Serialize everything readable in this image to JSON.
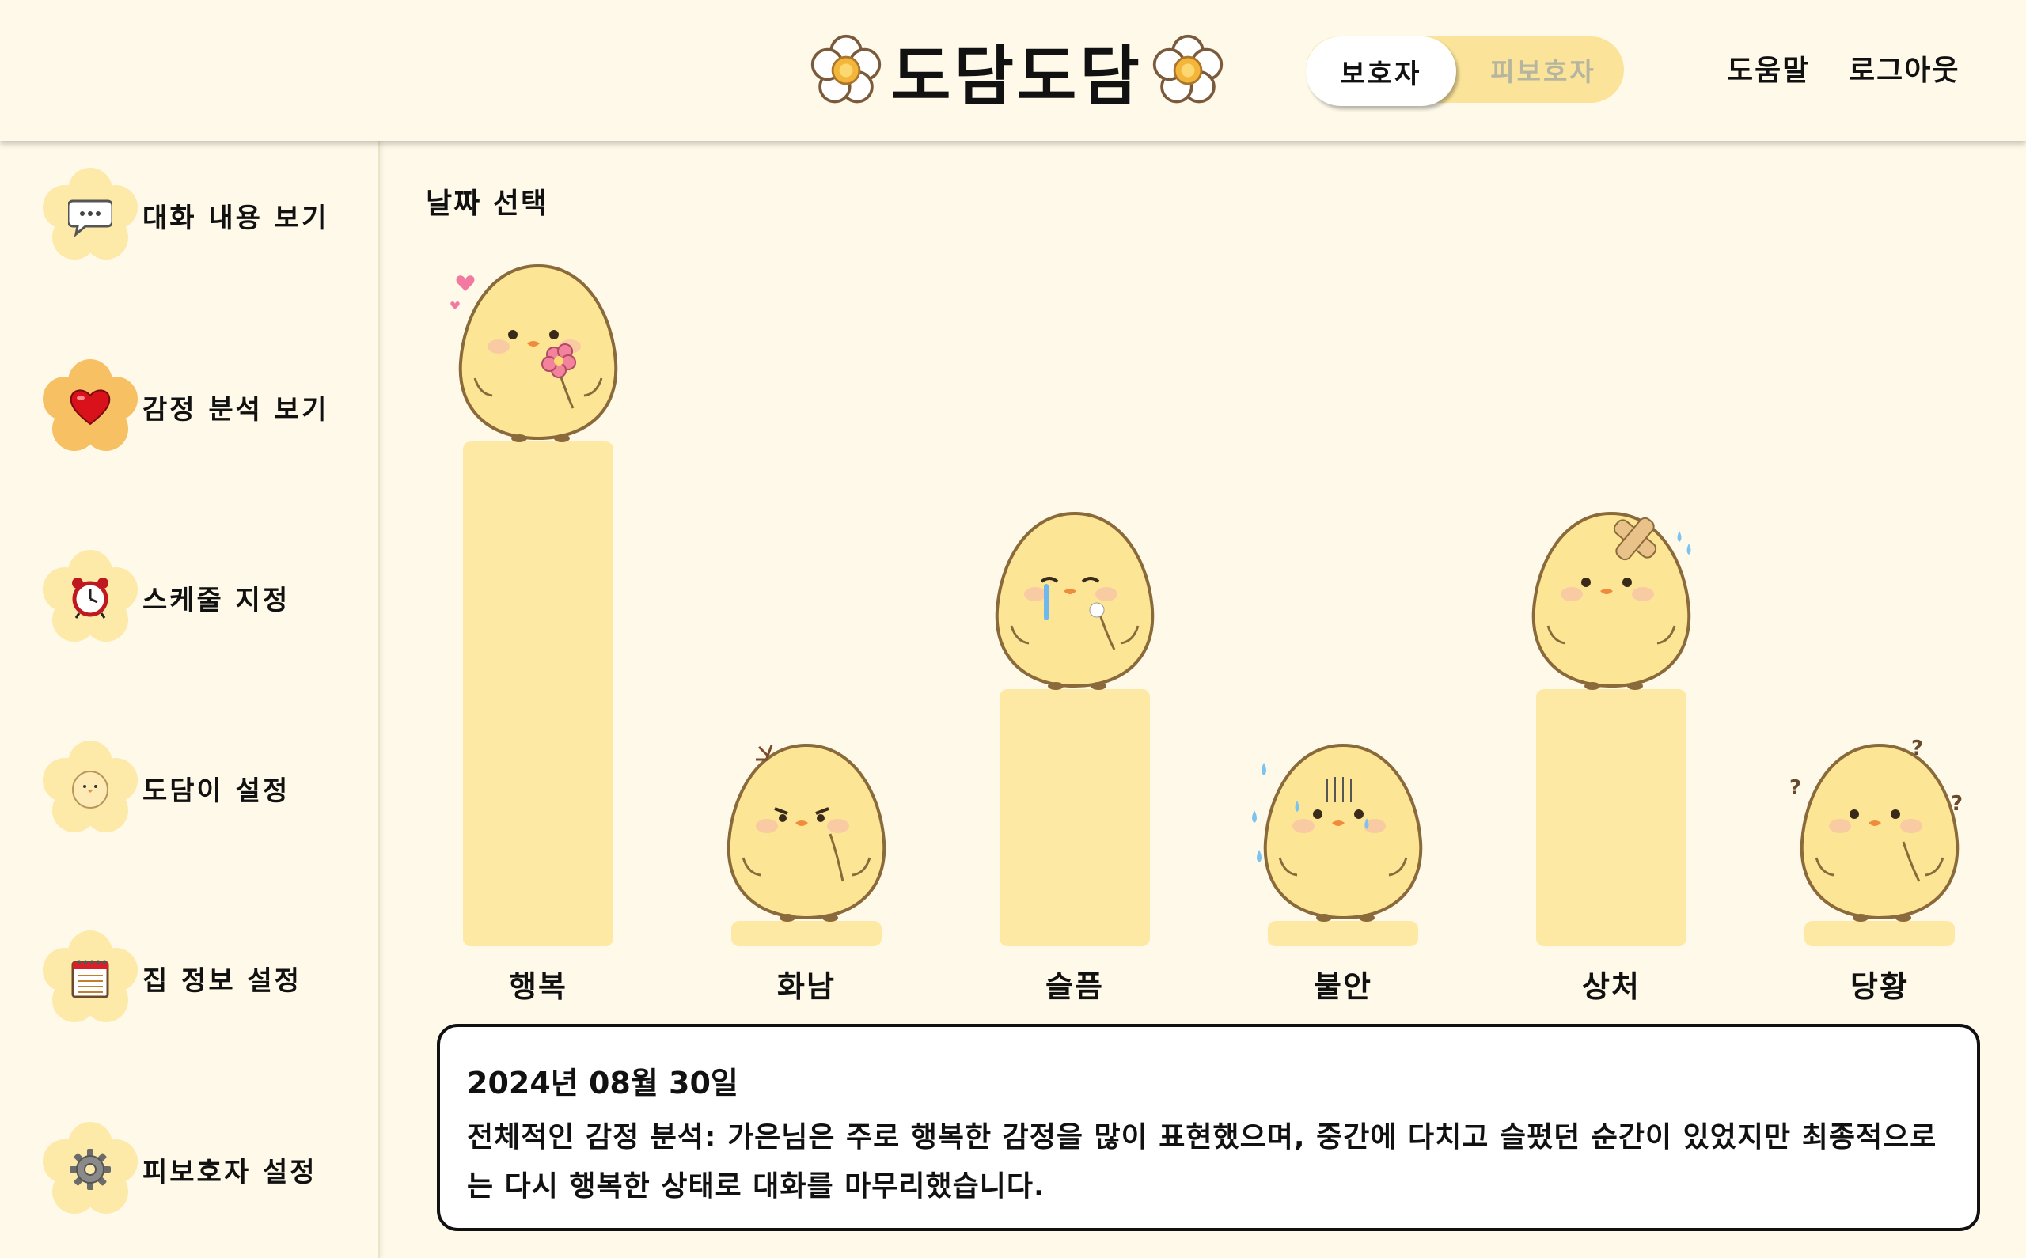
{
  "header": {
    "title": "도담도담",
    "role_toggle": {
      "active": "보호자",
      "inactive": "피보호자"
    },
    "links": {
      "help": "도움말",
      "logout": "로그아웃"
    }
  },
  "sidebar": {
    "items": [
      {
        "label": "대화 내용 보기",
        "icon": "speech-bubble-icon"
      },
      {
        "label": "감정 분석 보기",
        "icon": "heart-icon",
        "active": true
      },
      {
        "label": "스케줄 지정",
        "icon": "alarm-clock-icon"
      },
      {
        "label": "도담이 설정",
        "icon": "chick-icon"
      },
      {
        "label": "집 정보 설정",
        "icon": "notepad-icon"
      },
      {
        "label": "피보호자 설정",
        "icon": "gear-icon"
      }
    ]
  },
  "main": {
    "date_select_label": "날짜 선택",
    "summary": {
      "date": "2024년 08월 30일",
      "text": "전체적인 감정 분석: 가은님은 주로 행복한 감정을 많이 표현했으며, 중간에 다치고 슬펐던 순간이 있었지만 최종적으로는 다시 행복한 상태로 대화를 마무리했습니다."
    }
  },
  "chart_data": {
    "type": "bar",
    "categories": [
      "행복",
      "화남",
      "슬픔",
      "불안",
      "상처",
      "당황"
    ],
    "values": [
      100,
      5,
      51,
      5,
      51,
      5
    ],
    "ylim": [
      0,
      100
    ],
    "grid": false,
    "chick_expressions": [
      "happy-chick-icon",
      "angry-chick-icon",
      "sad-chick-icon",
      "anxious-chick-icon",
      "hurt-chick-icon",
      "confused-chick-icon"
    ]
  },
  "colors": {
    "background": "#fef9e9",
    "bar": "#fde8a4",
    "toggle_track": "#fbe49a",
    "accent_flower": "#f6c063",
    "light_flower": "#fde9a8"
  }
}
